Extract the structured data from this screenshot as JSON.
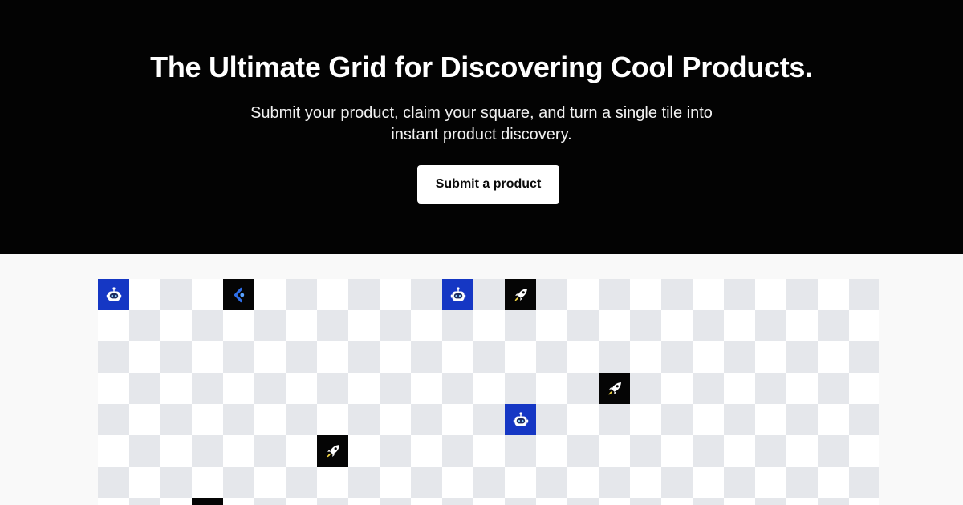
{
  "hero": {
    "title": "The Ultimate Grid for Discovering Cool Products.",
    "subtitle": "Submit your product, claim your square, and turn a single tile into instant product discovery.",
    "cta_label": "Submit a product"
  },
  "colors": {
    "hero_background": "#030303",
    "page_background": "#f9f9f9",
    "cell_light": "#ffffff",
    "cell_dark": "#e5e7eb",
    "robot_tile": "#1537c4",
    "dark_tile": "#050505",
    "rocket_flame": "#f5d742"
  },
  "grid": {
    "columns": 25,
    "visible_rows": 8,
    "filled_tiles": [
      {
        "row": 0,
        "col": 0,
        "icon": "robot-icon",
        "bg": "#1537c4"
      },
      {
        "row": 0,
        "col": 4,
        "icon": "blue-logo-icon",
        "bg": "#050505"
      },
      {
        "row": 0,
        "col": 11,
        "icon": "robot-icon",
        "bg": "#1537c4"
      },
      {
        "row": 0,
        "col": 13,
        "icon": "rocket-icon",
        "bg": "#050505"
      },
      {
        "row": 3,
        "col": 16,
        "icon": "rocket-icon",
        "bg": "#050505"
      },
      {
        "row": 4,
        "col": 13,
        "icon": "robot-icon",
        "bg": "#1537c4"
      },
      {
        "row": 5,
        "col": 7,
        "icon": "rocket-icon",
        "bg": "#050505"
      },
      {
        "row": 7,
        "col": 3,
        "icon": "blank-tile",
        "bg": "#050505"
      }
    ]
  }
}
